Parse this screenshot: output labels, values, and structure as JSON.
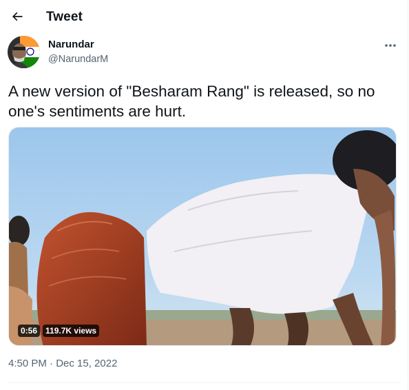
{
  "header": {
    "back_icon": "arrow-left-icon",
    "title": "Tweet"
  },
  "tweet": {
    "author": {
      "display_name": "Narundar",
      "handle": "@NarundarM",
      "avatar_icon": "avatar-image"
    },
    "more_icon": "more-horizontal-icon",
    "text": "A new version of \"Besharam Rang\" is released, so no one's sentiments are hurt.",
    "media": {
      "type": "video",
      "duration": "0:56",
      "views": "119.7K views"
    },
    "timestamp": "4:50 PM · Dec 15, 2022"
  },
  "colors": {
    "text_primary": "#0f1419",
    "text_secondary": "#536471",
    "divider": "#eff3f4"
  }
}
